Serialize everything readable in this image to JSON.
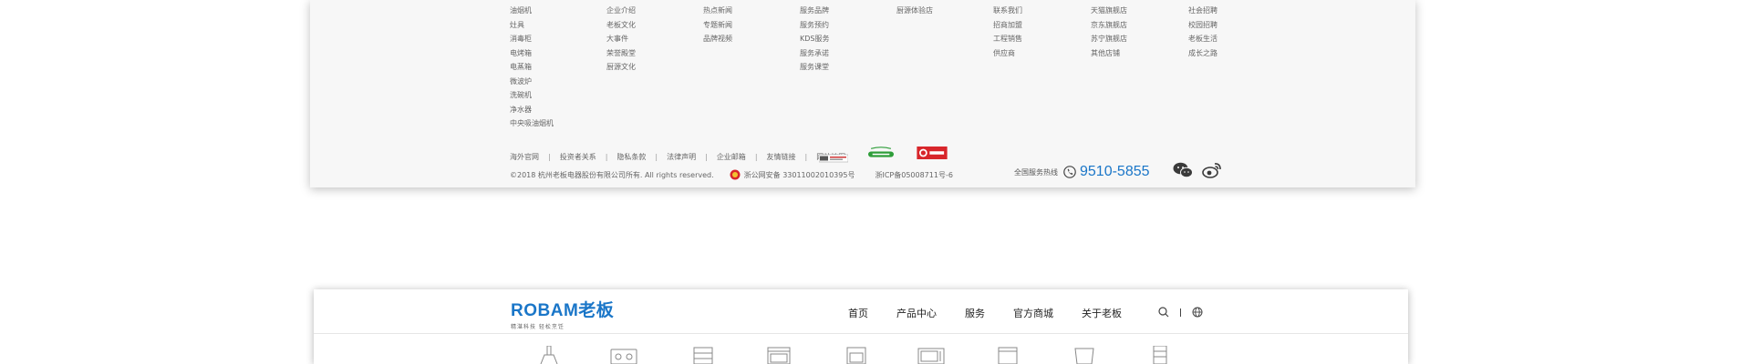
{
  "footer": {
    "columns": [
      {
        "items": [
          "油烟机",
          "灶具",
          "消毒柜",
          "电烤箱",
          "电蒸箱",
          "微波炉",
          "洗碗机",
          "净水器",
          "中央吸油烟机"
        ]
      },
      {
        "items": [
          "企业介绍",
          "老板文化",
          "大事件",
          "荣誉殿堂",
          "厨源文化"
        ]
      },
      {
        "items": [
          "热点新闻",
          "专题新闻",
          "品牌视频"
        ]
      },
      {
        "items": [
          "服务品牌",
          "服务预约",
          "KDS服务",
          "服务承诺",
          "服务课堂"
        ]
      },
      {
        "items": [
          "厨源体验店"
        ]
      },
      {
        "items": [
          "联系我们",
          "招商加盟",
          "工程销售",
          "供应商"
        ]
      },
      {
        "items": [
          "天猫旗舰店",
          "京东旗舰店",
          "苏宁旗舰店",
          "其他店铺"
        ]
      },
      {
        "items": [
          "社会招聘",
          "校园招聘",
          "老板生活",
          "成长之路"
        ]
      }
    ],
    "bottom_links": [
      "海外官网",
      "投资者关系",
      "隐私条款",
      "法律声明",
      "企业邮箱",
      "友情链接",
      "网站地图"
    ],
    "copyright": "©2018 杭州老板电器股份有限公司所有. All rights reserved.",
    "police_record": "浙公网安备 33011002010395号",
    "icp": "浙ICP备05008711号-6",
    "hotline_label": "全国服务热线",
    "hotline_number": "9510-5855",
    "colors": {
      "accent": "#1a76c8",
      "green_badge": "#2f9e3a",
      "red_badge": "#d8262b"
    }
  },
  "header": {
    "logo_text": "ROBAM老板",
    "logo_tagline": "精湛科技 轻松烹饪",
    "nav": [
      "首页",
      "产品中心",
      "服务",
      "官方商城",
      "关于老板"
    ],
    "tools": [
      "search-icon",
      "globe-icon"
    ]
  },
  "products": [
    "range-hood-icon",
    "gas-hob-icon",
    "disinfection-cabinet-icon",
    "steam-oven-icon",
    "built-in-oven-icon",
    "microwave-icon",
    "dishwasher-icon",
    "water-purifier-icon",
    "integrated-stove-icon"
  ]
}
